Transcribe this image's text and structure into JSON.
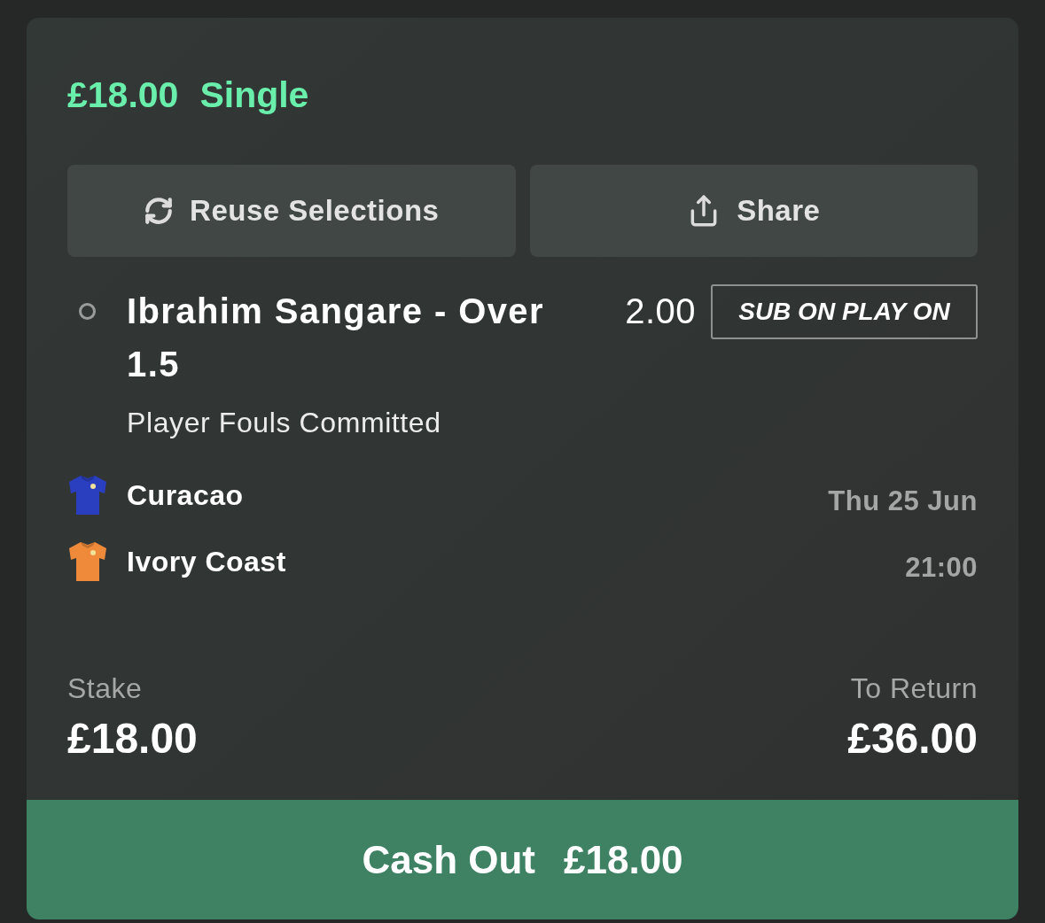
{
  "bet": {
    "stake_amount": "£18.00",
    "bet_type": "Single"
  },
  "actions": [
    {
      "kind": "reuse",
      "label": "Reuse Selections"
    },
    {
      "kind": "share",
      "label": "Share"
    }
  ],
  "selection": {
    "title": "Ibrahim Sangare - Over 1.5",
    "odds": "2.00",
    "badge": "SUB ON PLAY ON",
    "market": "Player Fouls Committed"
  },
  "teams": [
    {
      "name": "Curacao",
      "color": "#2a3fc0"
    },
    {
      "name": "Ivory Coast",
      "color": "#ef8a3a"
    }
  ],
  "event_time": {
    "date": "Thu 25 Jun",
    "time": "21:00"
  },
  "stake": {
    "label": "Stake",
    "value": "£18.00"
  },
  "returns": {
    "label": "To Return",
    "value": "£36.00"
  },
  "cash_out": {
    "label": "Cash Out",
    "amount": "£18.00"
  }
}
